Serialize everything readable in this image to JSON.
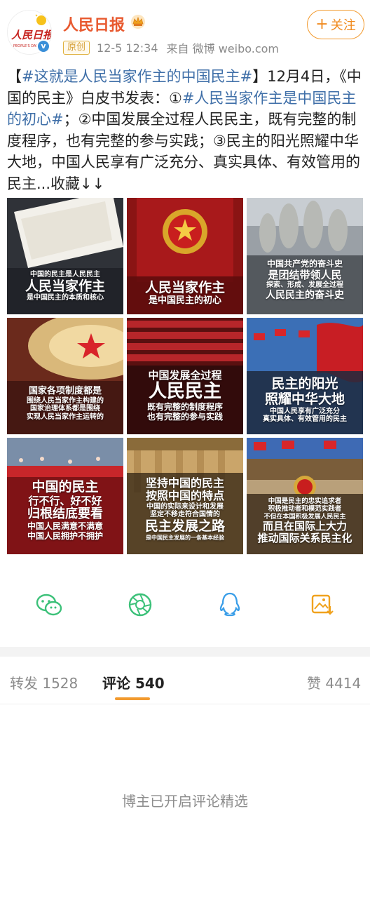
{
  "post": {
    "author": "人民日报",
    "origin_badge": "原创",
    "time": "12-5 12:34",
    "source": "来自 微博 weibo.com",
    "follow_label": "关注",
    "text": {
      "hashtag1": "#这就是人民当家作主的中国民主#",
      "part1": "12月4日，《中国的民主》白皮书发表：①",
      "hashtag2": "#人民当家作主是中国民主的初心#",
      "part2": "；②中国发展全过程人民民主，既有完整的制度程序，也有完整的参与实践；③民主的阳光照耀中华大地，中国人民享有广泛充分、真实具体、有效管用的民主...收藏↓↓"
    },
    "logo_text": "PEOPLE'S DAILY"
  },
  "images": [
    {
      "lines": [
        "中国的民主是人民民主",
        "人民当家作主",
        "是中国民主的本质和核心"
      ]
    },
    {
      "lines": [
        "人民当家作主",
        "是中国民主的初心"
      ]
    },
    {
      "lines": [
        "中国共产党的奋斗史",
        "是团结带领人民",
        "探索、形成、发展全过程",
        "人民民主的奋斗史"
      ]
    },
    {
      "lines": [
        "国家各项制度都是",
        "围绕人民当家作主构建的",
        "国家治理体系都是围绕",
        "实现人民当家作主运转的"
      ]
    },
    {
      "lines": [
        "中国发展全过程",
        "人民民主",
        "既有完整的制度程序",
        "也有完整的参与实践"
      ]
    },
    {
      "lines": [
        "民主的阳光",
        "照耀中华大地",
        "中国人民享有广泛充分",
        "真实具体、有效管用的民主"
      ]
    },
    {
      "lines": [
        "中国的民主",
        "行不行、好不好",
        "归根结底要看",
        "中国人民满意不满意",
        "中国人民拥护不拥护"
      ]
    },
    {
      "lines": [
        "坚持中国的民主",
        "按照中国的特点",
        "中国的实际来设计和发展",
        "坚定不移走符合国情的",
        "民主发展之路",
        "是中国民主发展的一条基本经验"
      ]
    },
    {
      "lines": [
        "中国是民主的忠实追求者",
        "积极推动者和模范实践者",
        "不但在本国积极发展人民民主",
        "而且在国际上大力",
        "推动国际关系民主化"
      ]
    }
  ],
  "share_icons": [
    "wechat-icon",
    "moments-icon",
    "qq-icon",
    "save-image-icon"
  ],
  "tabs": {
    "repost_label": "转发",
    "repost_count": "1528",
    "comment_label": "评论",
    "comment_count": "540",
    "like_label": "赞",
    "like_count": "4414"
  },
  "notice": "博主已开启评论精选",
  "colors": {
    "author": "#e8592f",
    "tag": "#3f6fa8",
    "accent": "#f29a2e"
  }
}
